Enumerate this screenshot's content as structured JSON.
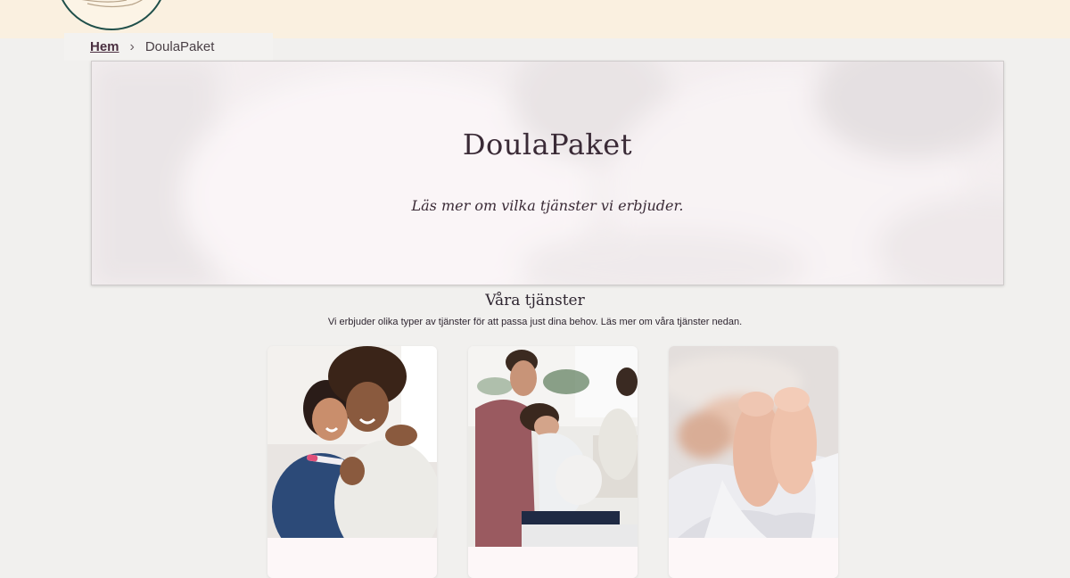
{
  "breadcrumb": {
    "home_label": "Hem",
    "separator": "›",
    "current_label": "DoulaPaket"
  },
  "hero": {
    "title": "DoulaPaket",
    "subtitle": "Läs mer om vilka tjänster vi erbjuder."
  },
  "services": {
    "title": "Våra tjänster",
    "description": "Vi erbjuder olika typer av tjänster för att passa just dina behov. Läs mer om våra tjänster nedan."
  },
  "colors": {
    "banner": "#faf0e0",
    "page_background": "#f1f0ee",
    "text": "#2f2530",
    "logo_ring": "#1f4f4a"
  }
}
